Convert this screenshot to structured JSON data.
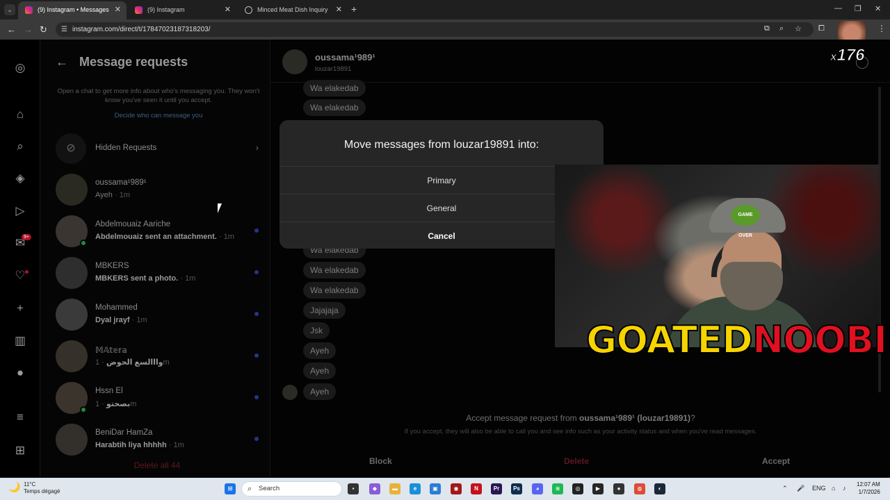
{
  "browser": {
    "tabs": [
      {
        "label": "(9) Instagram • Messages",
        "active": true
      },
      {
        "label": "(9) Instagram",
        "active": false
      },
      {
        "label": "Minced Meat Dish Inquiry",
        "active": false
      }
    ],
    "url": "instagram.com/direct/t/17847023187318203/"
  },
  "requests": {
    "title": "Message requests",
    "info": "Open a chat to get more info about who's messaging you. They won't know you've seen it until you accept.",
    "link": "Decide who can message you",
    "hidden_label": "Hidden Requests",
    "items": [
      {
        "name": "oussama¹989¹",
        "preview": "Ayeh",
        "time": "· 1m",
        "bold": false,
        "unread": false,
        "online": false
      },
      {
        "name": "Abdelmouaiz Aariche",
        "preview": "Abdelmouaiz sent an attachment.",
        "time": "· 1m",
        "bold": true,
        "unread": true,
        "online": true
      },
      {
        "name": "MBKERS",
        "preview": "MBKERS sent a photo.",
        "time": "· 1m",
        "bold": true,
        "unread": true,
        "online": false
      },
      {
        "name": "Mohammed",
        "preview": "Dyal jrayf",
        "time": "· 1m",
        "bold": true,
        "unread": true,
        "online": false
      },
      {
        "name": "𝕄𝔸𝕥𝕖𝕣𝕒",
        "preview": "وااالسع الحوض",
        "time": "· 1m",
        "bold": true,
        "unread": true,
        "online": false
      },
      {
        "name": "Hssn El",
        "preview": "بصحتو",
        "time": "· 1m",
        "bold": true,
        "unread": true,
        "online": true
      },
      {
        "name": "BeniDar HamZa",
        "preview": "Harabtih liya hhhhh",
        "time": "· 1m",
        "bold": true,
        "unread": true,
        "online": false
      }
    ],
    "delete_all": "Delete all 44"
  },
  "chat": {
    "name": "oussama¹989¹",
    "username": "louzar19891",
    "messages": [
      "Wa elakedab",
      "Wa elakedab",
      "Wa elakedab",
      "Wa elakedab",
      "Wa elakedab",
      "Jajajaja",
      "Jsk",
      "Ayeh",
      "Ayeh",
      "Ayeh"
    ],
    "accept_prefix": "Accept message request from ",
    "accept_name": "oussama¹989¹ (louzar19891)",
    "accept_suffix": "?",
    "accept_info": "If you accept, they will also be able to call you and see info such as your activity status and when you've read messages.",
    "actions": {
      "block": "Block",
      "delete": "Delete",
      "accept": "Accept"
    }
  },
  "modal": {
    "title": "Move messages from louzar19891 into:",
    "options": [
      "Primary",
      "General"
    ],
    "cancel": "Cancel"
  },
  "overlay": {
    "counter_prefix": "x",
    "counter_value": "176",
    "brand_yellow": "GOATED",
    "brand_red": "NOOBIE",
    "cap_badge": "GAME OVER"
  },
  "rail": {
    "badge": "9+"
  },
  "taskbar": {
    "weather_temp": "11°C",
    "weather_desc": "Temps dégagé",
    "search_placeholder": "Search",
    "lang": "ENG",
    "time": "12:07 AM",
    "date": "1/7/2026"
  }
}
